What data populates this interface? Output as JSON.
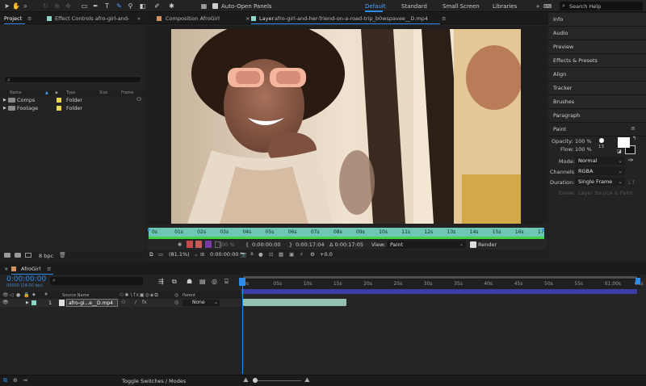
{
  "toolbar": {
    "auto_open_panels": "Auto-Open Panels",
    "workspaces": [
      "Default",
      "Standard",
      "Small Screen",
      "Libraries"
    ],
    "search_placeholder": "Search Help"
  },
  "project": {
    "tab_project": "Project",
    "tab_effect_controls": "Effect Controls afro-girl-and-",
    "columns": {
      "name": "Name",
      "type": "Type",
      "size": "Size",
      "frame": "Frame"
    },
    "items": [
      {
        "name": "Comps",
        "type": "Folder"
      },
      {
        "name": "Footage",
        "type": "Folder"
      }
    ],
    "bpc": "8 bpc"
  },
  "composition": {
    "tab_comp": "Composition AfroGirl",
    "tab_layer_prefix": "Layer",
    "tab_layer_name": "afro-girl-and-her-friend-on-a-road-trip_b0wspavee__D.mp4",
    "ruler_labels": [
      "0s",
      "01s",
      "02s",
      "03s",
      "04s",
      "05s",
      "06s",
      "07s",
      "08s",
      "09s",
      "10s",
      "11s",
      "12s",
      "13s",
      "14s",
      "15s",
      "16s",
      "17s"
    ],
    "controls": {
      "opacity_pct": "100 %",
      "in_time": "0:00:00:00",
      "out_time": "0:00:17:04",
      "duration": "Δ 0:00:17:05",
      "view_label": "View:",
      "view_value": "Paint",
      "render_label": "Render",
      "zoom": "(81.1%)",
      "current_time": "0:00:00:00",
      "exposure": "+0.0"
    }
  },
  "right_panel": {
    "sections": [
      "Info",
      "Audio",
      "Preview",
      "Effects & Presets",
      "Align",
      "Tracker",
      "Brushes",
      "Paragraph",
      "Paint"
    ],
    "paint": {
      "opacity_label": "Opacity:",
      "opacity_value": "100 %",
      "flow_label": "Flow:",
      "flow_value": "100 %",
      "brush_size": "13",
      "mode_label": "Mode:",
      "mode_value": "Normal",
      "channels_label": "Channels:",
      "channels_value": "RGBA",
      "duration_label": "Duration:",
      "duration_value": "Single Frame",
      "erase_label": "Erase:",
      "erase_value": "Layer Source & Paint"
    }
  },
  "timeline": {
    "tab": "AfroGirl",
    "current_time": "0:00:00:00",
    "fps": "00000 (24.00 fps)",
    "source_name_col": "Source Name",
    "parent_col": "Parent",
    "layer_number": "1",
    "layer_name": "afro-gi...e__D.mp4",
    "parent_value": "None",
    "ruler_labels": [
      "0s",
      "05s",
      "10s",
      "15s",
      "20s",
      "25s",
      "30s",
      "35s",
      "40s",
      "45s",
      "50s",
      "55s",
      "01:00s",
      "05s"
    ],
    "toggle_label": "Toggle Switches / Modes"
  },
  "colors": {
    "accent": "#2d8ceb",
    "ruler_teal": "#6ec7b4",
    "work_area": "#3a3ea6",
    "layer_bar": "#93c0b2"
  }
}
